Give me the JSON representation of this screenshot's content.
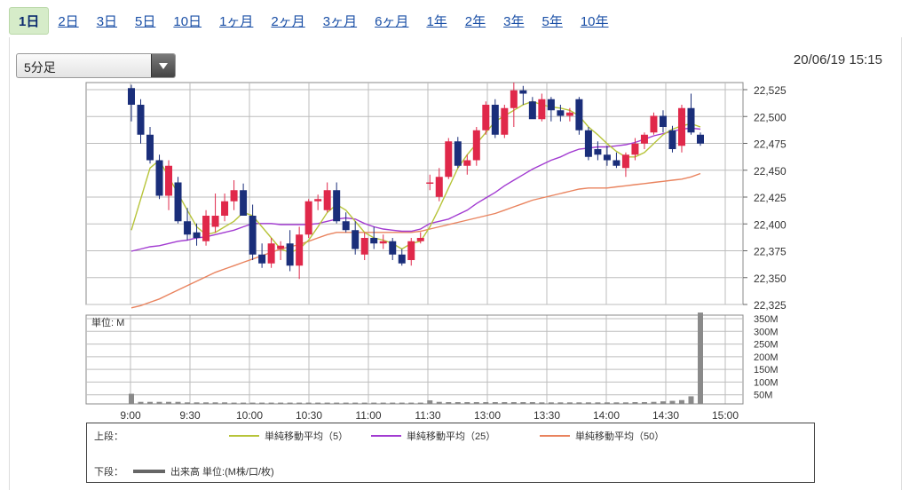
{
  "tabs": [
    {
      "label": "1日",
      "active": true
    },
    {
      "label": "2日"
    },
    {
      "label": "3日"
    },
    {
      "label": "5日"
    },
    {
      "label": "10日"
    },
    {
      "label": "1ヶ月"
    },
    {
      "label": "2ヶ月"
    },
    {
      "label": "3ヶ月"
    },
    {
      "label": "6ヶ月"
    },
    {
      "label": "1年"
    },
    {
      "label": "2年"
    },
    {
      "label": "3年"
    },
    {
      "label": "5年"
    },
    {
      "label": "10年"
    }
  ],
  "interval_select": {
    "value": "5分足"
  },
  "timestamp": {
    "date": "20/06/19",
    "time": "15:15"
  },
  "colors": {
    "up": "#e0284a",
    "down": "#1a2e7a",
    "ma5": "#b7c43a",
    "ma25": "#a23bd1",
    "ma50": "#e9835e",
    "volume": "#8a8a8a",
    "grid": "#bdbdbd"
  },
  "chart_data": {
    "type": "candlestick",
    "price_axis": {
      "min": 22325,
      "max": 22525,
      "ticks": [
        "22,525",
        "22,500",
        "22,475",
        "22,450",
        "22,425",
        "22,400",
        "22,375",
        "22,350",
        "22,325"
      ]
    },
    "time_axis": {
      "ticks": [
        "9:00",
        "9:30",
        "10:00",
        "10:30",
        "11:00",
        "11:30",
        "13:00",
        "13:30",
        "14:00",
        "14:30",
        "15:00"
      ]
    },
    "volume_axis": {
      "min": 0,
      "max": 350,
      "unit_label": "単位: M",
      "ticks": [
        "350M",
        "300M",
        "250M",
        "200M",
        "150M",
        "100M",
        "50M"
      ]
    },
    "candles": [
      [
        22520,
        22523,
        22490,
        22505
      ],
      [
        22505,
        22510,
        22470,
        22478
      ],
      [
        22478,
        22485,
        22452,
        22455
      ],
      [
        22455,
        22460,
        22420,
        22423
      ],
      [
        22423,
        22455,
        22410,
        22450
      ],
      [
        22435,
        22440,
        22398,
        22400
      ],
      [
        22400,
        22412,
        22383,
        22388
      ],
      [
        22390,
        22398,
        22378,
        22385
      ],
      [
        22382,
        22410,
        22378,
        22405
      ],
      [
        22395,
        22425,
        22390,
        22405
      ],
      [
        22405,
        22425,
        22400,
        22418
      ],
      [
        22418,
        22437,
        22410,
        22428
      ],
      [
        22428,
        22434,
        22405,
        22405
      ],
      [
        22405,
        22415,
        22365,
        22370
      ],
      [
        22370,
        22380,
        22358,
        22362
      ],
      [
        22362,
        22385,
        22358,
        22380
      ],
      [
        22375,
        22382,
        22365,
        22378
      ],
      [
        22380,
        22392,
        22355,
        22360
      ],
      [
        22360,
        22395,
        22348,
        22388
      ],
      [
        22388,
        22420,
        22385,
        22418
      ],
      [
        22418,
        22424,
        22410,
        22420
      ],
      [
        22410,
        22435,
        22408,
        22428
      ],
      [
        22428,
        22435,
        22398,
        22400
      ],
      [
        22400,
        22408,
        22390,
        22392
      ],
      [
        22392,
        22400,
        22370,
        22375
      ],
      [
        22370,
        22390,
        22365,
        22385
      ],
      [
        22385,
        22395,
        22375,
        22380
      ],
      [
        22380,
        22388,
        22375,
        22382
      ],
      [
        22382,
        22385,
        22365,
        22370
      ],
      [
        22370,
        22375,
        22360,
        22362
      ],
      [
        22365,
        22385,
        22360,
        22382
      ],
      [
        22382,
        22390,
        22380,
        22385
      ],
      [
        22435,
        22442,
        22428,
        22435
      ],
      [
        22422,
        22448,
        22418,
        22440
      ],
      [
        22440,
        22475,
        22438,
        22472
      ],
      [
        22472,
        22476,
        22448,
        22450
      ],
      [
        22450,
        22460,
        22442,
        22455
      ],
      [
        22455,
        22485,
        22450,
        22482
      ],
      [
        22482,
        22508,
        22478,
        22505
      ],
      [
        22505,
        22510,
        22475,
        22478
      ],
      [
        22478,
        22505,
        22475,
        22502
      ],
      [
        22502,
        22525,
        22485,
        22518
      ],
      [
        22518,
        22522,
        22505,
        22515
      ],
      [
        22508,
        22512,
        22495,
        22492
      ],
      [
        22492,
        22515,
        22490,
        22510
      ],
      [
        22510,
        22512,
        22490,
        22500
      ],
      [
        22500,
        22505,
        22490,
        22495
      ],
      [
        22495,
        22502,
        22490,
        22498
      ],
      [
        22510,
        22512,
        22478,
        22482
      ],
      [
        22482,
        22485,
        22455,
        22458
      ],
      [
        22465,
        22472,
        22455,
        22460
      ],
      [
        22460,
        22468,
        22450,
        22455
      ],
      [
        22455,
        22462,
        22448,
        22450
      ],
      [
        22448,
        22462,
        22440,
        22460
      ],
      [
        22460,
        22475,
        22455,
        22470
      ],
      [
        22470,
        22480,
        22465,
        22478
      ],
      [
        22480,
        22498,
        22478,
        22495
      ],
      [
        22495,
        22500,
        22480,
        22485
      ],
      [
        22482,
        22486,
        22462,
        22465
      ],
      [
        22468,
        22505,
        22462,
        22502
      ],
      [
        22502,
        22515,
        22478,
        22480
      ],
      [
        22478,
        22480,
        22468,
        22470
      ]
    ],
    "ma5": [
      22392,
      22420,
      22448,
      22455,
      22440,
      22425,
      22410,
      22395,
      22388,
      22390,
      22395,
      22400,
      22408,
      22405,
      22395,
      22385,
      22375,
      22372,
      22375,
      22383,
      22395,
      22408,
      22415,
      22410,
      22400,
      22390,
      22385,
      22383,
      22380,
      22375,
      22380,
      22382,
      22395,
      22412,
      22430,
      22448,
      22460,
      22470,
      22480,
      22490,
      22495,
      22500,
      22505,
      22508,
      22505,
      22503,
      22502,
      22500,
      22495,
      22485,
      22478,
      22470,
      22463,
      22458,
      22458,
      22462,
      22470,
      22478,
      22483,
      22486,
      22488,
      22485
    ],
    "ma25": [
      22373,
      22375,
      22377,
      22378,
      22380,
      22382,
      22383,
      22385,
      22386,
      22388,
      22390,
      22392,
      22395,
      22398,
      22398,
      22398,
      22397,
      22397,
      22397,
      22397,
      22398,
      22400,
      22402,
      22403,
      22402,
      22398,
      22395,
      22393,
      22392,
      22391,
      22391,
      22393,
      22398,
      22400,
      22402,
      22406,
      22410,
      22416,
      22421,
      22426,
      22432,
      22437,
      22442,
      22447,
      22451,
      22455,
      22458,
      22462,
      22465,
      22466,
      22467,
      22467,
      22468,
      22469,
      22471,
      22474,
      22477,
      22479,
      22481,
      22483,
      22484,
      22483
    ],
    "ma50": [
      22322,
      22324,
      22327,
      22330,
      22334,
      22338,
      22342,
      22346,
      22350,
      22354,
      22357,
      22360,
      22363,
      22366,
      22369,
      22372,
      22375,
      22377,
      22379,
      22382,
      22385,
      22388,
      22390,
      22390,
      22390,
      22390,
      22390,
      22390,
      22390,
      22390,
      22390,
      22391,
      22393,
      22395,
      22397,
      22399,
      22401,
      22403,
      22405,
      22407,
      22410,
      22413,
      22416,
      22419,
      22421,
      22423,
      22425,
      22427,
      22429,
      22430,
      22430,
      22430,
      22431,
      22432,
      22433,
      22434,
      22435,
      22436,
      22437,
      22438,
      22440,
      22443
    ],
    "volume": [
      40,
      8,
      8,
      8,
      8,
      8,
      6,
      6,
      6,
      6,
      6,
      5,
      5,
      5,
      5,
      5,
      5,
      5,
      5,
      5,
      5,
      5,
      5,
      5,
      5,
      5,
      5,
      5,
      5,
      5,
      5,
      5,
      14,
      8,
      7,
      7,
      7,
      7,
      7,
      7,
      7,
      7,
      7,
      7,
      6,
      6,
      6,
      6,
      6,
      6,
      6,
      6,
      6,
      6,
      7,
      7,
      8,
      10,
      12,
      15,
      30,
      360
    ],
    "legend": {
      "upper_label": "上段：",
      "lower_label": "下段：",
      "series": [
        {
          "key": "ma5",
          "name": "単純移動平均（5）"
        },
        {
          "key": "ma25",
          "name": "単純移動平均（25）"
        },
        {
          "key": "ma50",
          "name": "単純移動平均（50）"
        }
      ],
      "volume_name": "出来高 単位:(M株/口/枚)"
    }
  }
}
